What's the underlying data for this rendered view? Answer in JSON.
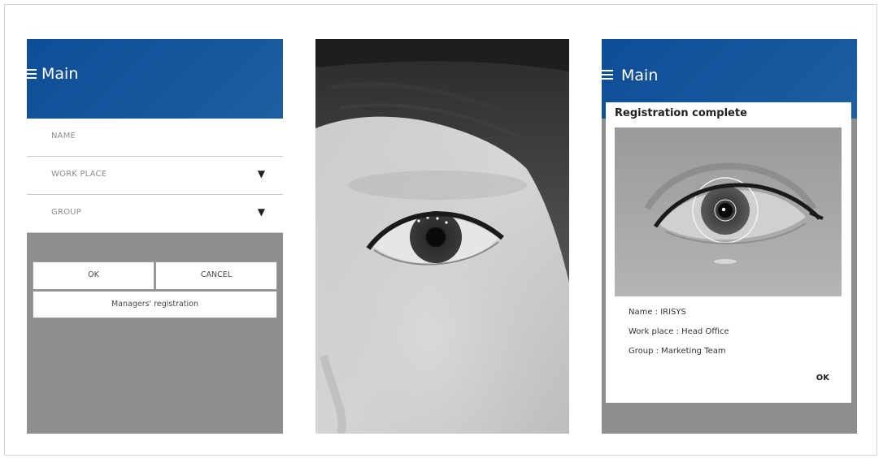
{
  "form_screen": {
    "title": "Main",
    "fields": [
      {
        "label": "NAME"
      },
      {
        "label": "WORK PLACE",
        "has_dropdown": true
      },
      {
        "label": "GROUP",
        "has_dropdown": true
      }
    ],
    "ok_label": "OK",
    "cancel_label": "CANCEL",
    "managers_label": "Managers' registration",
    "icons": {
      "menu": "menu-icon",
      "dropdown": "triangle-down-icon"
    }
  },
  "result_screen": {
    "title": "Main",
    "dialog_title": "Registration complete",
    "name_line": "Name : IRISYS",
    "workplace_line": "Work place : Head Office",
    "group_line": "Group : Marketing Team",
    "ok_label": "OK"
  },
  "colors": {
    "app_bar": "#15569d",
    "background_gray": "#8e8e8e",
    "white": "#ffffff"
  }
}
